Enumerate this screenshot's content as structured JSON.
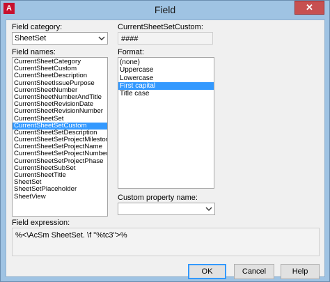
{
  "window": {
    "title": "Field",
    "app_icon_letter": "A",
    "close_label": "✕"
  },
  "field_category": {
    "label": "Field category:",
    "value": "SheetSet"
  },
  "field_names": {
    "label": "Field names:",
    "items": [
      "CurrentSheetCategory",
      "CurrentSheetCustom",
      "CurrentSheetDescription",
      "CurrentSheetIssuePurpose",
      "CurrentSheetNumber",
      "CurrentSheetNumberAndTitle",
      "CurrentSheetRevisionDate",
      "CurrentSheetRevisionNumber",
      "CurrentSheetSet",
      "CurrentSheetSetCustom",
      "CurrentSheetSetDescription",
      "CurrentSheetSetProjectMilestone",
      "CurrentSheetSetProjectName",
      "CurrentSheetSetProjectNumber",
      "CurrentSheetSetProjectPhase",
      "CurrentSheetSubSet",
      "CurrentSheetTitle",
      "SheetSet",
      "SheetSetPlaceholder",
      "SheetView"
    ],
    "selected": "CurrentSheetSetCustom"
  },
  "current_value": {
    "label": "CurrentSheetSetCustom:",
    "value": "####"
  },
  "format": {
    "label": "Format:",
    "items": [
      "(none)",
      "Uppercase",
      "Lowercase",
      "First capital",
      "Title case"
    ],
    "selected": "First capital"
  },
  "custom_property": {
    "label": "Custom property name:",
    "value": ""
  },
  "field_expression": {
    "label": "Field expression:",
    "value": "%<\\AcSm SheetSet. \\f \"%tc3\">%"
  },
  "buttons": {
    "ok": "OK",
    "cancel": "Cancel",
    "help": "Help"
  },
  "colors": {
    "selection": "#3399ff",
    "title_bar": "#9fc3e3",
    "close_button": "#c75050"
  }
}
